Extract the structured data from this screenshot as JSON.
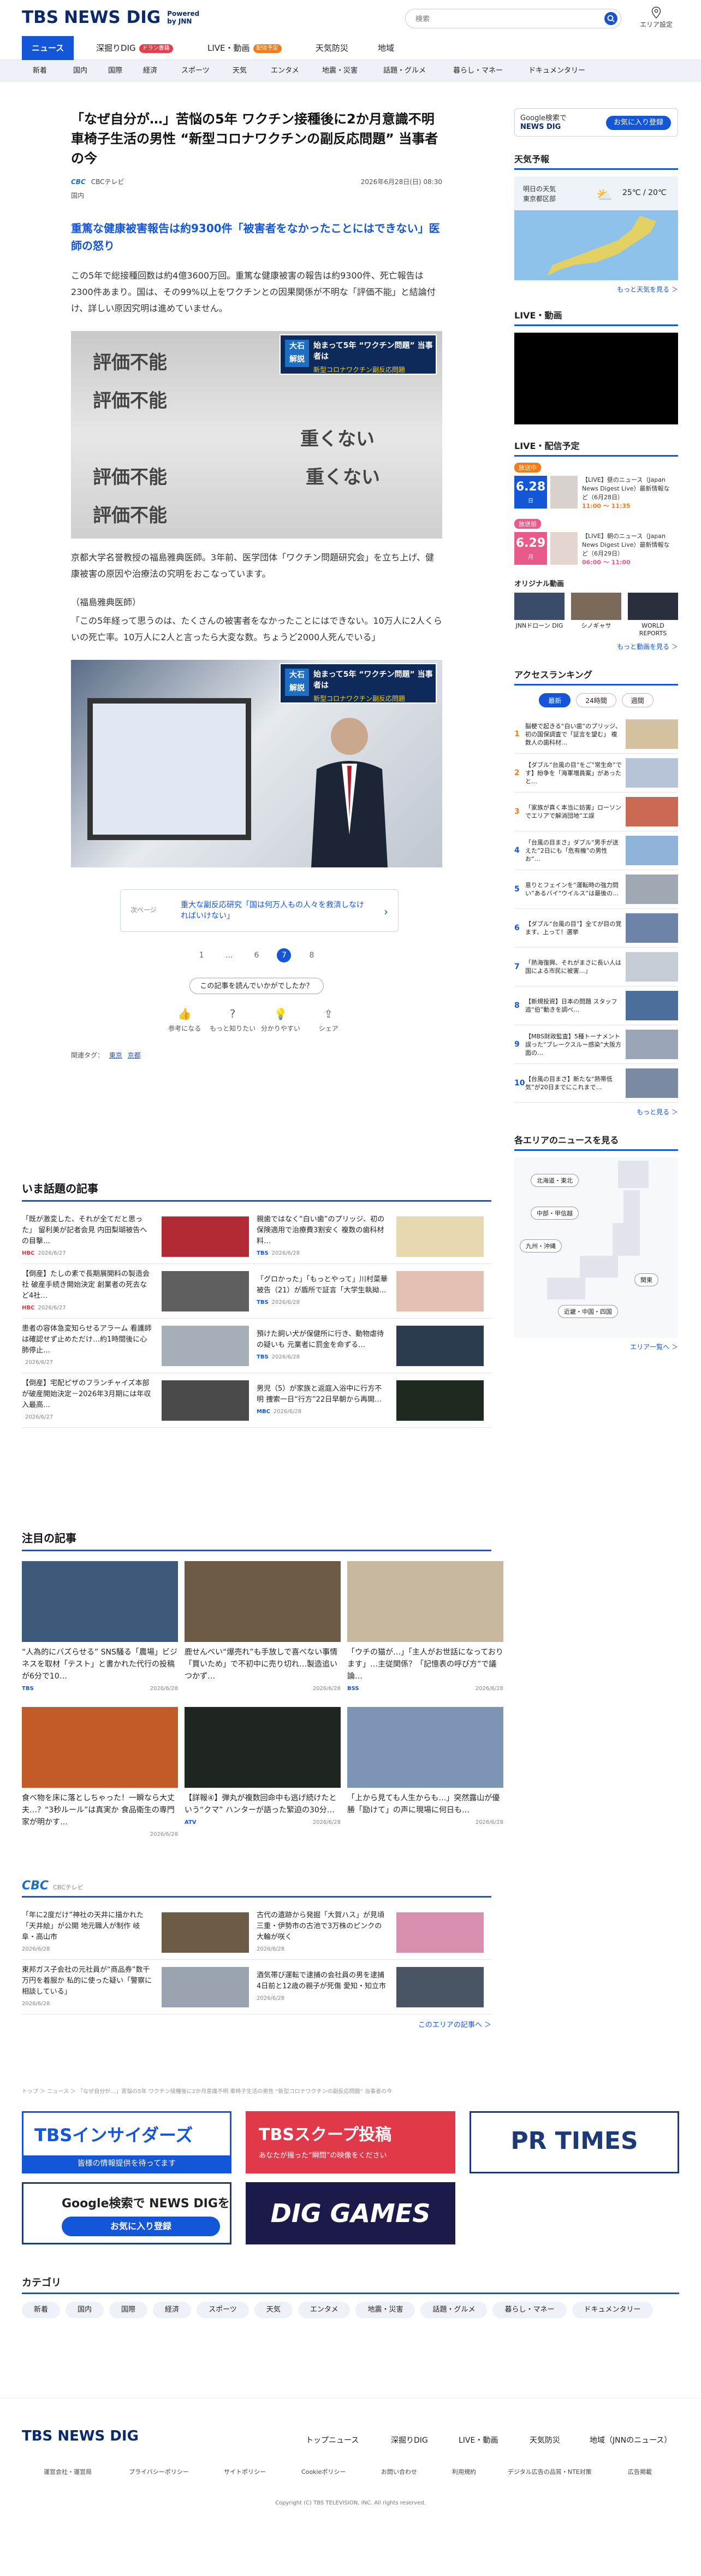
{
  "header": {
    "logo_main": "TBS",
    "logo_sub": "NEWS DIG",
    "powered": "Powered\nby JNN",
    "search_placeholder": "検索",
    "area_label": "エリア設定"
  },
  "nav": {
    "items": [
      {
        "label": "ニュース",
        "active": true
      },
      {
        "label": "深掘りDIG",
        "badge": "ドラン書籍"
      },
      {
        "label": "LIVE・動画",
        "badge": "配信予定"
      },
      {
        "label": "天気防災"
      },
      {
        "label": "地域"
      }
    ],
    "categories": [
      "新着",
      "国内",
      "国際",
      "経済",
      "スポーツ",
      "天気",
      "エンタメ",
      "地震・災害",
      "話題・グルメ",
      "暮らし・マネー",
      "ドキュメンタリー"
    ]
  },
  "article": {
    "title": "「なぜ自分が…」苦悩の5年 ワクチン接種後に2か月意識不明 車椅子生活の男性 “新型コロナワクチンの副反応問題” 当事者の今",
    "source": "CBCテレビ",
    "source_logo": "CBC",
    "date": "2026年6月28日(日) 08:30",
    "region": "国内",
    "lead": "重篤な健康被害報告は約9300件「被害者をなかったことにはできない」医師の怒り",
    "para1": "この5年で総接種回数は約4億3600万回。重篤な健康被害の報告は約9300件、死亡報告は2300件あまり。国は、その99%以上をワクチンとの因果関係が不明な「評価不能」と結論付け、詳しい原因究明は進めていません。",
    "photo1": {
      "overlay_badge": "大石\n解説",
      "overlay_title": "始まって5年 “ワクチン問題” 当事者は",
      "overlay_sub": "新型コロナワクチン副反応問題",
      "text_lines": [
        "評価不能",
        "評価不能",
        "重くない",
        "評価不能",
        "評価不能",
        "重くない"
      ]
    },
    "caption": "京都大学名誉教授の福島雅典医師。3年前、医学団体「ワクチン問題研究会」を立ち上げ、健康被害の原因や治療法の究明をおこなっています。",
    "quote_head": "（福島雅典医師）",
    "quote": "「この5年経って思うのは、たくさんの被害者をなかったことにはできない。10万人に2人くらいの死亡率。10万人に2人と言ったら大変な数。ちょうど2000人死んでいる」",
    "photo2": {
      "overlay_badge": "大石\n解説",
      "overlay_title": "始まって5年 “ワクチン問題” 当事者は",
      "overlay_sub": "新型コロナワクチン副反応問題"
    },
    "related": {
      "label": "次ページ",
      "text": "重大な副反応研究「国は何万人もの人々を救済しなければいけない」"
    },
    "pages": [
      "1",
      "…",
      "6",
      "7",
      "8"
    ],
    "current_page": "7",
    "feedback_button": "この記事を読んでいかがでしたか？",
    "reactions": [
      {
        "icon": "thumb",
        "label": "参考になる"
      },
      {
        "icon": "question",
        "label": "もっと知りたい"
      },
      {
        "icon": "lightbulb",
        "label": "分かりやすい"
      },
      {
        "icon": "share",
        "label": "シェア"
      }
    ],
    "tags_label": "関連タグ：",
    "tags": [
      "東京",
      "京都"
    ]
  },
  "sidebar": {
    "google_btn": {
      "line1": "Google検索で",
      "line2": "NEWS DIG",
      "fav": "お気に入り登録"
    },
    "weather_title": "天気予報",
    "weather_text": "明日の天気\n東京都区部",
    "weather_temp": "25℃ / 20℃",
    "weather_more": "もっと天気を見る ＞",
    "live_title": "LIVE・動画",
    "live_more": "もっと見る ＞",
    "schedule_title": "LIVE・配信予定",
    "schedule": [
      {
        "tag": "放送中",
        "date": "6.28",
        "dow": "日",
        "label": "【LIVE】昼のニュース（Japan News Digest Live）最新情報など（6月28日）",
        "time": "11:00 〜 11:35"
      },
      {
        "tag": "放送前",
        "date": "6.29",
        "dow": "月",
        "label": "【LIVE】朝のニュース（Japan News Digest Live）最新情報など（6月29日）",
        "time": "06:00 〜 11:00"
      }
    ],
    "original_title": "オリジナル動画",
    "originals": [
      "JNNドローン DIG",
      "シノギャサ",
      "WORLD REPORTS"
    ],
    "original_more": "もっと動画を見る ＞",
    "ranking_title": "アクセスランキング",
    "ranking_tabs": [
      "最新",
      "24時間",
      "週間"
    ],
    "ranking_items": [
      "脳梗で起きる“白い歯”のプリッジ、初の国保調査で「証言を望む」 複数人の歯科材…",
      "【ダブル“台風の目”をご“常生命”です】紛争を「海軍増員案」があったと…",
      "「家族が真く本当に妨害」ローソンでエリアで解消団地”エ誤",
      "「台風の目まさ」ダブル“男手が送えた”2日にも「危有機”の男性 お“…",
      "意りとフェインを“運転時の強力問い”あるバイ“ウイルス”は最後の…",
      "【ダブル“台風の目”】全てが目の覚ます、上って！選挙",
      "「熱海復興、それがまさに長い人は国による市民に被害…」",
      "【新規投資】日本の問題 スタッフ 追“伯”動きを調べ…",
      "【MBS財政監査】5種トーナメント 誤った“ブレークスルー感染”大阪方面の…",
      "【台風の目まさ】新たな“熱帯低気”が20日までにこれまで…"
    ],
    "ranking_more": "もっと見る ＞",
    "region_title": "各エリアのニュースを見る",
    "region_buttons": [
      "北海道・東北",
      "中部・甲信越",
      "九州・沖縄",
      "関東",
      "近畿・中国・四国"
    ],
    "region_more": "エリア一覧へ ＞"
  },
  "now_section": {
    "title": "いま話題の記事",
    "items": [
      {
        "text": "「既が激変した、それが全てだと思った」 留利美が記者会見 内田梨瑚被告への目撃…",
        "co": "HBC",
        "date": "2026/6/27"
      },
      {
        "text": "親歯ではなく“白い歯”のプリッジ、初の保険適用で治療費3割安く 複数の歯科材料…",
        "co": "TBS",
        "date": "2026/6/28"
      },
      {
        "text": "【倒産】たしの素で長期展開料の製造会社 破産手続き開始決定 創業者の死去など4社…",
        "co": "HBC",
        "date": "2026/6/27"
      },
      {
        "text": "「グロかった」「もっとやって」川村菜華被告（21）が盾所で証言「大学生執拗…",
        "co": "TBS",
        "date": "2026/6/28"
      },
      {
        "text": "患者の容体急変知らせるアラーム 看護師は確認せず止めただけ…約1時間後に心肺停止…",
        "co": "",
        "date": "2026/6/27"
      },
      {
        "text": "預けた飼い犬が保健所に行き、動物虐待の疑いも 元業者に罰金を命ずる…",
        "co": "TBS",
        "date": "2026/6/28"
      },
      {
        "text": "【倒産】宅配ピザのフランチャイズ本部が破産開始決定－2026年3月期には年収入最高…",
        "co": "",
        "date": "2026/6/27"
      },
      {
        "text": "男児（5）が家族と返庭入浴中に行方不明 捜索一日“行方”22日早朝から再開…",
        "co": "MBC",
        "date": "2026/6/28"
      }
    ]
  },
  "attention_section": {
    "title": "注目の記事",
    "items": [
      {
        "text": "“人為的にバズらせる” SNS騒る「農場」ビジネスを取材「テスト」と書かれた代行の投稿が6分で10…",
        "co": "TBS",
        "date": "2026/6/28"
      },
      {
        "text": "鹿せんべい“爆売れ”も手放しで喜べない事情「買いため」で不初中に売り切れ…製造追いつかず…",
        "co": "",
        "date": "2026/6/28"
      },
      {
        "text": "「ウチの猫が…」「主人がお世話になっております」…主従関係？「記憶表の呼び方”で議論…",
        "co": "BSS",
        "date": "2026/6/28"
      },
      {
        "text": "食べ物を床に落としちゃった！一瞬なら大丈夫…？“3秒ルール”は真実か 食品衛生の専門家が明かす…",
        "co": "",
        "date": "2026/6/28"
      },
      {
        "text": "【詳報④】弾丸が複数回命中も逃げ続けたという“クマ” ハンターが語った緊迫の30分…",
        "co": "ATV",
        "date": "2026/6/28"
      },
      {
        "text": "「上から見ても人生からも…」突然露山が優勝「励けて」の声に現場に何日も…",
        "co": "",
        "date": "2026/6/28"
      }
    ]
  },
  "cbc_section": {
    "logo": "CBC",
    "sub": "CBCテレビ",
    "items": [
      {
        "text": "「年に2度だけ”神社の天井に描かれた「天井絵」が公開 地元職人が制作 岐阜・高山市",
        "date": "2026/6/28"
      },
      {
        "text": "古代の遺跡から発掘「大賀ハス」が見頃 三重・伊勢市の古池で3万株のピンクの大輪が咲く",
        "date": "2026/6/28"
      },
      {
        "text": "東邦ガス子会社の元社員が“商品券”数千万円を着服か 私的に使った疑い「警察に相談している」",
        "date": "2026/6/28"
      },
      {
        "text": "酒気帯び運転で逮捕の会社員の男を逮捕 4日前と12歳の親子が死傷 愛知・知立市",
        "date": "2026/6/28"
      }
    ],
    "more": "このエリアの記事へ ＞"
  },
  "breadcrumb": "トップ ＞ ニュース ＞ 「なぜ自分が…」苦悩の5年 ワクチン接種後に2か月意識不明 車椅子生活の男性 “新型コロナワクチンの副反応問題” 当事者の今",
  "banners": [
    {
      "name": "insiders",
      "title": "TBSインサイダーズ",
      "sub": "皆様の情報提供を待ってます"
    },
    {
      "name": "scoop",
      "title": "TBSスクープ投稿",
      "sub": "あなたが撮った“瞬間”の映像をください"
    },
    {
      "name": "prtimes",
      "title": "PR TIMES"
    },
    {
      "name": "google",
      "title": "Google検索で NEWS DIGを",
      "sub": "お気に入り登録"
    },
    {
      "name": "games",
      "title": "DIG GAMES"
    }
  ],
  "category_section": {
    "title": "カテゴリ",
    "items": [
      "新着",
      "国内",
      "国際",
      "経済",
      "スポーツ",
      "天気",
      "エンタメ",
      "地震・災害",
      "話題・グルメ",
      "暮らし・マネー",
      "ドキュメンタリー"
    ]
  },
  "footer": {
    "logo": "TBS NEWS DIG",
    "nav": [
      "トップニュース",
      "深掘りDIG",
      "LIVE・動画",
      "天気防災",
      "地域（JNNのニュース）"
    ],
    "links": [
      "運営会社・運営局",
      "プライバシーポリシー",
      "サイトポリシー",
      "Cookieポリシー",
      "お問い合わせ",
      "利用規約",
      "デジタル広告の品質・NTE対策",
      "広告掲載"
    ],
    "copyright": "Copyright (C) TBS TELEVISION, INC. All rights reserved."
  }
}
